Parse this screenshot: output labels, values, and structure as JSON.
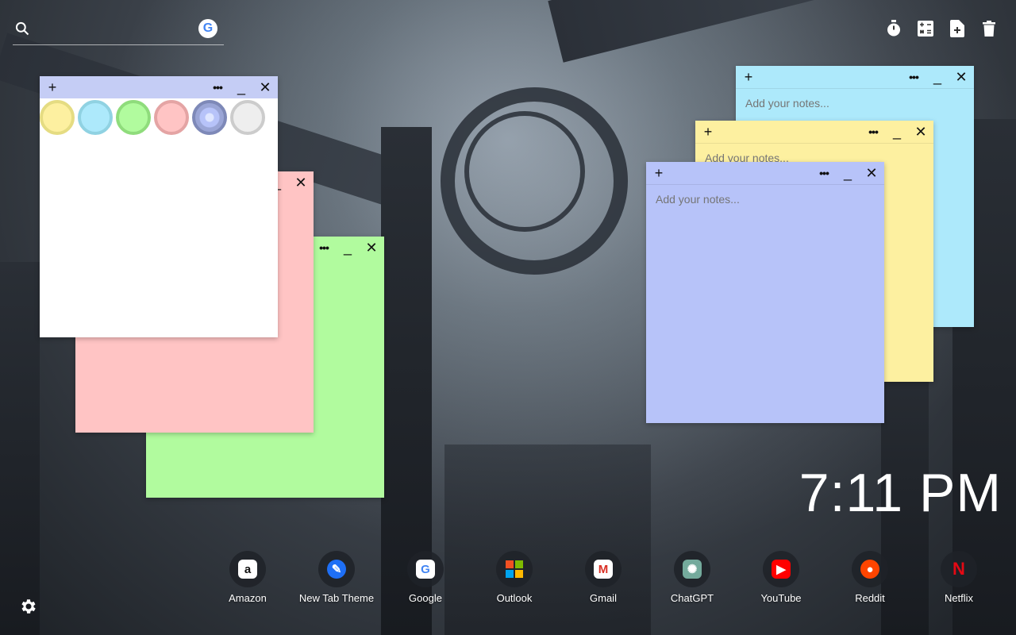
{
  "search": {
    "placeholder": "",
    "value": "",
    "engine_icon": "google-icon"
  },
  "tools": [
    {
      "name": "timer-icon"
    },
    {
      "name": "calculator-icon"
    },
    {
      "name": "new-note-icon"
    },
    {
      "name": "delete-icon"
    }
  ],
  "notes": {
    "white": {
      "color": "#ffffff",
      "bar_color": "#c5cdf5",
      "text": ""
    },
    "pink": {
      "color": "#ffc4c4",
      "bar_color": "#ffc4c4",
      "text": ""
    },
    "green": {
      "color": "#b1fb9e",
      "bar_color": "#b1fb9e",
      "text": ""
    },
    "cyan": {
      "color": "#ade9fb",
      "bar_color": "#ade9fb",
      "placeholder": "Add your notes..."
    },
    "yellow": {
      "color": "#fdf0a0",
      "bar_color": "#fdf0a0",
      "placeholder": "Add your notes..."
    },
    "blue": {
      "color": "#b7c3f9",
      "bar_color": "#b7c3f9",
      "placeholder": "Add your notes..."
    }
  },
  "note_controls": {
    "add": "+",
    "menu": "•••",
    "minimize": "_",
    "close": "✕"
  },
  "color_picker": [
    {
      "name": "yellow",
      "fill": "#fdf0a0",
      "ring": "#e5dc82"
    },
    {
      "name": "cyan",
      "fill": "#ade9fb",
      "ring": "#90d2e2"
    },
    {
      "name": "green",
      "fill": "#b1fb9e",
      "ring": "#8fdc7c"
    },
    {
      "name": "pink",
      "fill": "#ffc4c4",
      "ring": "#e4a4a4"
    },
    {
      "name": "blue",
      "fill": "#b7c3f9",
      "ring": "#7e89b8",
      "selected": true
    },
    {
      "name": "grey",
      "fill": "#eeeeee",
      "ring": "#cccccc"
    }
  ],
  "clock": "7:11 PM",
  "apps": [
    {
      "label": "Amazon",
      "icon": "amazon-icon",
      "glyph": "a",
      "bg": "#ffffff",
      "fg": "#111111"
    },
    {
      "label": "New Tab Theme",
      "icon": "new-tab-theme-icon",
      "glyph": "✎",
      "bg": "#1e6ff5",
      "fg": "#ffffff"
    },
    {
      "label": "Google",
      "icon": "google-icon",
      "glyph": "G",
      "bg": "#ffffff",
      "fg": "#4285f4"
    },
    {
      "label": "Outlook",
      "icon": "outlook-icon",
      "glyph": "",
      "bg": "#ffffff",
      "fg": "#ffffff"
    },
    {
      "label": "Gmail",
      "icon": "gmail-icon",
      "glyph": "M",
      "bg": "#ffffff",
      "fg": "#d93025"
    },
    {
      "label": "ChatGPT",
      "icon": "chatgpt-icon",
      "glyph": "✺",
      "bg": "#74aa9c",
      "fg": "#ffffff"
    },
    {
      "label": "YouTube",
      "icon": "youtube-icon",
      "glyph": "▶",
      "bg": "#ff0000",
      "fg": "#ffffff"
    },
    {
      "label": "Reddit",
      "icon": "reddit-icon",
      "glyph": "●",
      "bg": "#ff4500",
      "fg": "#ffffff"
    },
    {
      "label": "Netflix",
      "icon": "netflix-icon",
      "glyph": "N",
      "bg": "transparent",
      "fg": "#e50914"
    }
  ]
}
